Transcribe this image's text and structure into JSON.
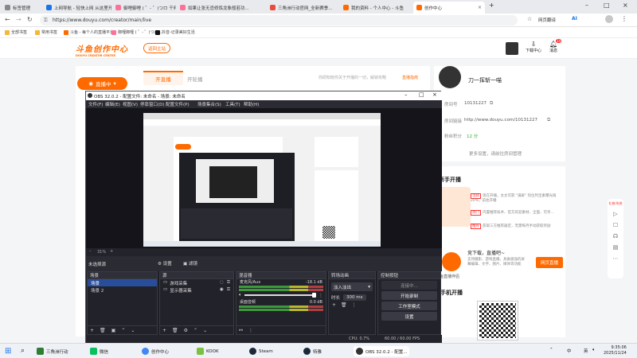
{
  "browser": {
    "tabs": [
      {
        "title": "标签管理",
        "color": "#888"
      },
      {
        "title": "上网导航 - 轻快上网 从这里开始",
        "color": "#1a73e8"
      },
      {
        "title": "御哩御哩 ( ゜- ゜)つロ 干杯~-bili",
        "color": "#fb7299"
      },
      {
        "title": "如果让张无忌修炼龙象般若功...",
        "color": "#fb7299"
      },
      {
        "title": "三角洲行动官网_全新赛季...",
        "color": "#e74c3c"
      },
      {
        "title": "我的资料 - 个人中心 - 斗鱼",
        "color": "#ff6a00"
      },
      {
        "title": "创作中心",
        "color": "#ff6a00"
      }
    ],
    "new_tab": "+",
    "url": "https://www.douyu.com/creator/main/live",
    "translate_label": "网页翻译",
    "ai_label": "AI",
    "bookmarks": [
      "全部书签",
      "常用书签",
      "斗鱼 - 每个人的直播平台",
      "御哩御哩 ( ゜- ゜)つロ...",
      "抖音-记录美好生活"
    ]
  },
  "douyu": {
    "logo_text": "斗鱼创作中心",
    "logo_sub": "DOUYU CREATOR CENTER",
    "back_label": "返回主站",
    "download_label": "下载中心",
    "message_label": "消息",
    "message_count": "14",
    "live_badge": "直播中",
    "tab_start": "开直播",
    "tab_replay": "开轮播",
    "notice": "你即知晓你关于开播的一切，解锁攻略",
    "notice_link": "直播指南",
    "username": "刀一挥斩一喵",
    "room_label": "房间号",
    "room_id": "10131227",
    "link_label": "房间链接",
    "room_url": "http://www.douyu.com/10131227",
    "score_label": "粉丝积分",
    "score": "12 分",
    "more_settings": "更多设置，请前往房间管理",
    "guide_title": "新手开播",
    "tips": [
      {
        "tag": "活跃",
        "text": "现在开播，太太可获 \"满屏\" 热位列宝素曝光值20%，前往开播"
      },
      {
        "tag": "热门",
        "text": "内置推荐技术、官方欢迎素材、全面、可享..."
      },
      {
        "tag": "推荐",
        "text": "获取三方推荐器定，无需每月手动获取奖励"
      }
    ],
    "helper_title": "斗鱼直播伴侣",
    "promo_title": "竞下载，直播吧~",
    "promo_text": "支持摄影、游戏直播，具备极强的屏幕编辑、文字、图片、媒体等功能",
    "web_live_btn": "网页直播",
    "mobile_title": "手机开播",
    "mobile_helper": "斗鱼直播伴侣",
    "sidebar": [
      "礼物/系统",
      "播放",
      "消息",
      "客服",
      "报告",
      "更多"
    ]
  },
  "obs": {
    "title": "OBS 32.0.2 - 配置文件: 未命名 - 场景: 未命名",
    "menu": [
      "文件(F)",
      "编辑(E)",
      "视图(V)",
      "停靠窗口(D)",
      "配置文件(P)",
      "场景集合(S)",
      "工具(T)",
      "帮助(H)"
    ],
    "zoom": "31%",
    "source_label": "未选择源",
    "props_btn": "设置",
    "filters_btn": "滤镜",
    "scenes_title": "场景",
    "scenes": [
      "场景",
      "场景 2"
    ],
    "sources_title": "源",
    "sources": [
      "游戏采集",
      "显示器采集"
    ],
    "mixer_title": "混音器",
    "mixer_channels": [
      {
        "name": "麦克风/Aux",
        "db": "-18.1 dB"
      },
      {
        "name": "桌面音频",
        "db": "0.0 dB"
      }
    ],
    "transitions_title": "转场动画",
    "transition_type": "淡入淡出",
    "duration_label": "时长",
    "duration_value": "300 ms",
    "controls_title": "控制按钮",
    "controls": [
      "连接中...",
      "开始录制",
      "工作室模式",
      "设置"
    ],
    "status_cpu": "CPU: 0.7%",
    "status_fps": "60.00 / 60.00 FPS",
    "status_time": "00:00:00"
  },
  "taskbar": {
    "apps": [
      {
        "label": "三角洲行动",
        "color": "#2e7d32"
      },
      {
        "label": "微信",
        "color": "#07c160"
      },
      {
        "label": "创作中心",
        "color": "#4285f4"
      },
      {
        "label": "KOOK",
        "color": "#7ac143"
      },
      {
        "label": "Steam",
        "color": "#1b2838"
      },
      {
        "label": "特雅",
        "color": "#1b2838"
      },
      {
        "label": "OBS 32.0.2 - 配置...",
        "color": "#333"
      }
    ],
    "ime": "中",
    "lang": "英",
    "time": "9:35:06",
    "date": "2025/11/24"
  },
  "colors": {
    "accent": "#ff6a00",
    "obs_bg": "#1e1e25",
    "obs_sel": "#284d9a"
  }
}
